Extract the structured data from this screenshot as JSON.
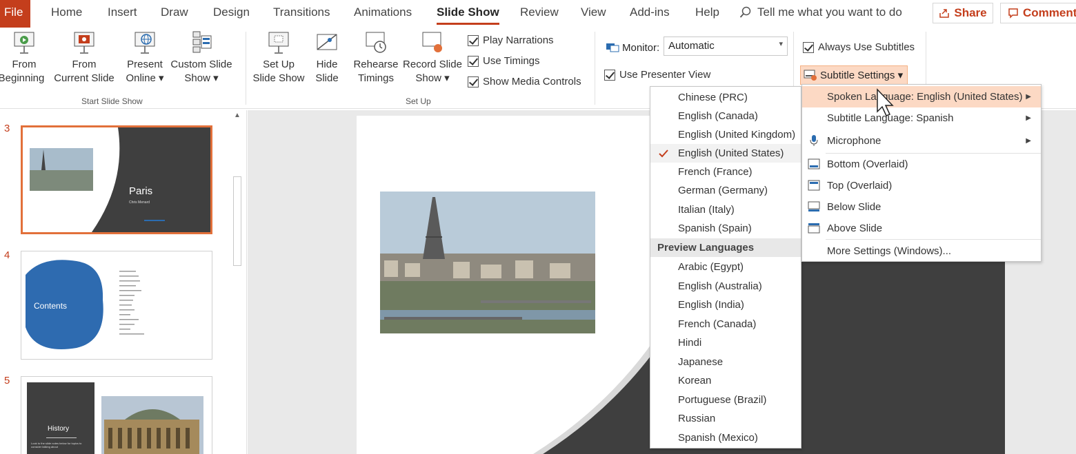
{
  "tabs": {
    "file": "File",
    "home": "Home",
    "insert": "Insert",
    "draw": "Draw",
    "design": "Design",
    "transitions": "Transitions",
    "animations": "Animations",
    "slideshow": "Slide Show",
    "review": "Review",
    "view": "View",
    "addins": "Add-ins",
    "help": "Help",
    "tellme": "Tell me what you want to do",
    "share": "Share",
    "comments": "Comments"
  },
  "ribbon": {
    "start_group": "Start Slide Show",
    "setup_group": "Set Up",
    "from_beginning": [
      "From",
      "Beginning"
    ],
    "from_current": [
      "From",
      "Current Slide"
    ],
    "present_online": [
      "Present",
      "Online ▾"
    ],
    "custom_show": [
      "Custom Slide",
      "Show ▾"
    ],
    "setup_show": [
      "Set Up",
      "Slide Show"
    ],
    "hide_slide": [
      "Hide",
      "Slide"
    ],
    "rehearse": [
      "Rehearse",
      "Timings"
    ],
    "record": [
      "Record Slide",
      "Show ▾"
    ],
    "play_narrations": "Play Narrations",
    "use_timings": "Use Timings",
    "show_media": "Show Media Controls",
    "monitor_label": "Monitor:",
    "monitor_value": "Automatic",
    "presenter_view": "Use Presenter View",
    "always_subtitles": "Always Use Subtitles",
    "subtitle_settings": "Subtitle Settings ▾"
  },
  "thumbs": {
    "n3": "3",
    "n4": "4",
    "n5": "5",
    "paris_title": "Paris",
    "paris_sub": "Chris Menard",
    "contents": "Contents",
    "history": "History",
    "history_sub": "Look to the slide notes below for topics to consider talking about"
  },
  "languages": {
    "items": [
      "Chinese (PRC)",
      "English (Canada)",
      "English (United Kingdom)",
      "English (United States)",
      "French (France)",
      "German (Germany)",
      "Italian (Italy)",
      "Spanish (Spain)"
    ],
    "preview_header": "Preview Languages",
    "preview": [
      "Arabic (Egypt)",
      "English (Australia)",
      "English (India)",
      "French (Canada)",
      "Hindi",
      "Japanese",
      "Korean",
      "Portuguese (Brazil)",
      "Russian",
      "Spanish (Mexico)"
    ],
    "checked": "English (United States)"
  },
  "subtitle_menu": {
    "spoken": "Spoken Language: English (United States)",
    "subtitle": "Subtitle Language: Spanish",
    "microphone": "Microphone",
    "bottom": "Bottom (Overlaid)",
    "top": "Top (Overlaid)",
    "below": "Below Slide",
    "above": "Above Slide",
    "more": "More Settings (Windows)..."
  },
  "colors": {
    "accent": "#c43e1c",
    "hover": "#fcd9c4",
    "slide_dark": "#3f3f3f"
  }
}
